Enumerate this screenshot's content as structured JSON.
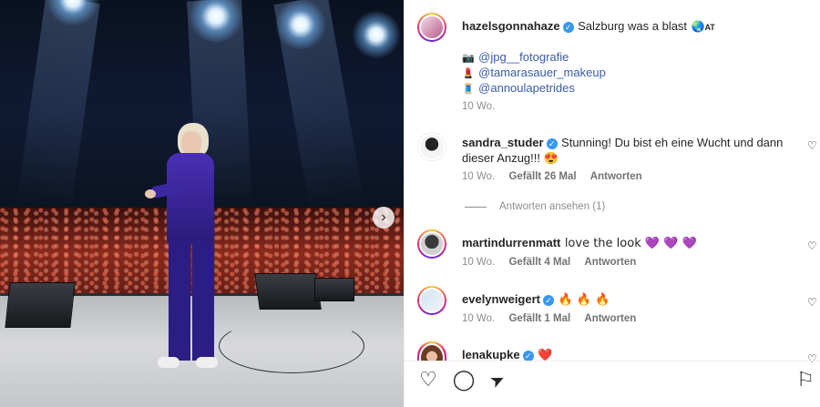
{
  "post": {
    "author": "hazelsgonnahaze",
    "caption": "Salzburg was a blast",
    "caption_flag": "AT",
    "credits": [
      {
        "emoji": "📷",
        "handle": "@jpg__fotografie"
      },
      {
        "emoji": "💄",
        "handle": "@tamarasauer_makeup"
      },
      {
        "emoji": "🧵",
        "handle": "@annoulapetrides"
      }
    ],
    "time": "10 Wo."
  },
  "comments": [
    {
      "user": "sandra_studer",
      "verified": true,
      "text_line1": "Stunning! Du bist eh eine Wucht und dann",
      "text_line2": "dieser Anzug!!! 😍",
      "time": "10 Wo.",
      "likes": "Gefällt 26 Mal",
      "reply": "Antworten",
      "view_replies": "Antworten ansehen (1)"
    },
    {
      "user": "martindurrenmatt",
      "verified": false,
      "text": "love the look 💜 💜 💜",
      "time": "10 Wo.",
      "likes": "Gefällt 4 Mal",
      "reply": "Antworten"
    },
    {
      "user": "evelynweigert",
      "verified": true,
      "text": "🔥 🔥 🔥",
      "time": "10 Wo.",
      "likes": "Gefällt 1 Mal",
      "reply": "Antworten"
    },
    {
      "user": "lenakupke",
      "verified": true,
      "text": "❤️"
    }
  ],
  "icons": {
    "verified": "✓",
    "next": "›",
    "heart": "♡",
    "like_action": "♡",
    "comment_action": "◯",
    "share_action": "➤",
    "save_action": "⚐"
  },
  "colors": {
    "verified": "#3897f0",
    "mention": "#3a5ba8",
    "muted": "#8e8e8e"
  }
}
